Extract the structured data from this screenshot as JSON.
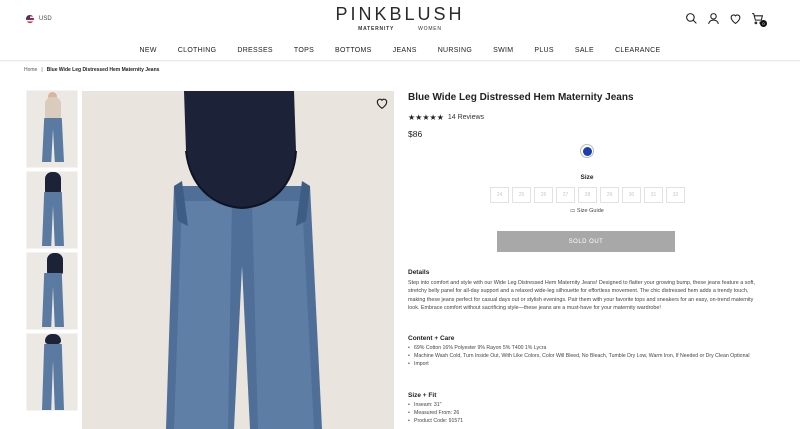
{
  "header": {
    "currency": "USD",
    "logo": "PINKBLUSH",
    "logo_sub_left": "MATERNITY",
    "logo_sub_right": "WOMEN",
    "cart_count": "0"
  },
  "nav": [
    "NEW",
    "CLOTHING",
    "DRESSES",
    "TOPS",
    "BOTTOMS",
    "JEANS",
    "NURSING",
    "SWIM",
    "PLUS",
    "SALE",
    "CLEARANCE"
  ],
  "breadcrumb": {
    "home": "Home",
    "separator": "|",
    "current": "Blue Wide Leg Distressed Hem Maternity Jeans"
  },
  "product": {
    "title": "Blue Wide Leg Distressed Hem Maternity Jeans",
    "stars": "★★★★★",
    "reviews": "14 Reviews",
    "price": "$86",
    "swatch_color": "#1a3fb0",
    "size_label": "Size",
    "sizes": [
      "24",
      "25",
      "26",
      "27",
      "28",
      "29",
      "30",
      "31",
      "32"
    ],
    "size_guide": "Size Guide",
    "sold_out": "SOLD OUT"
  },
  "details": {
    "heading": "Details",
    "text": "Step into comfort and style with our Wide Leg Distressed Hem Maternity Jeans! Designed to flatter your growing bump, these jeans feature a soft, stretchy belly panel for all-day support and a relaxed wide-leg silhouette for effortless movement. The chic distressed hem adds a trendy touch, making these jeans perfect for casual days out or stylish evenings. Pair them with your favorite tops and sneakers for an easy, on-trend maternity look. Embrace comfort without sacrificing style—these jeans are a must-have for your maternity wardrobe!"
  },
  "content_care": {
    "heading": "Content + Care",
    "items": [
      "69% Cotton 16% Polyester 9% Rayon 5% T400 1% Lycra",
      "Machine Wash Cold, Turn Inside Out, With Like Colors, Color Will Bleed, No Bleach, Tumble Dry Low, Warm Iron, If Needed or Dry Clean Optional",
      "Import"
    ]
  },
  "size_fit": {
    "heading": "Size + Fit",
    "items": [
      "Inseam: 31\"",
      "Measured From: 26",
      "Product Code: 91571"
    ]
  },
  "colors": {
    "belly_panel": "#1c2237",
    "denim": "#4f6f98",
    "denim_light": "#6f8db4",
    "background": "#e9e4dd",
    "sold_out_bg": "#a8a8a8"
  }
}
